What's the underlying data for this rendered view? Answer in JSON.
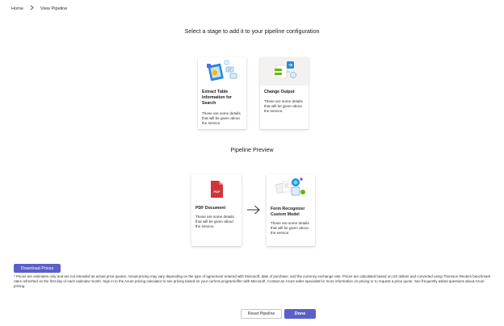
{
  "breadcrumb": {
    "items": [
      "Home",
      "View Pipeline"
    ],
    "separator_icon": "chevron-right-icon"
  },
  "stage_selection": {
    "heading": "Select a stage to add it to your pipeline configuration",
    "cards": [
      {
        "title": "Extract Table Information for Search",
        "description": "These are some details that will be given about the service.",
        "icon": "table-extraction-illustration"
      },
      {
        "title": "Change Output",
        "description": "These are some details that will be given about the service.",
        "icon": "output-transform-illustration"
      }
    ]
  },
  "pipeline_preview": {
    "heading": "Pipeline Preview",
    "arrow_icon": "arrow-right-icon",
    "cards": [
      {
        "title": "PDF Document",
        "description": "These are some details that will be given about the service.",
        "icon_text": "PDF",
        "icon": "pdf-file-icon"
      },
      {
        "title": "Form Recognizer Custom Model",
        "description": "These are some details that will be given about the service.",
        "icon": "form-recognizer-illustration"
      }
    ]
  },
  "pricing": {
    "download_label": "Download Prices",
    "disclaimer": "* Prices are estimates only and are not intended as actual price quotes. Actual pricing may vary depending on the type of agreement entered with Microsoft, date of purchase, and the currency exchange rate. Prices are calculated based on US dollars and converted using Thomson Reuters benchmark rates refreshed on the first day of each calendar month. Sign in to the Azure pricing calculator to see pricing based on your current program/offer with Microsoft. Contact an Azure sales specialist for more information on pricing or to request a price quote. See frequently asked questions about Azure pricing."
  },
  "actions": {
    "reset_label": "Reset Pipeline",
    "done_label": "Done"
  },
  "colors": {
    "primary": "#5b5fc7",
    "pdf_red": "#d13438",
    "illustration_blue": "#2b88d8",
    "illustration_green": "#6bb700"
  }
}
